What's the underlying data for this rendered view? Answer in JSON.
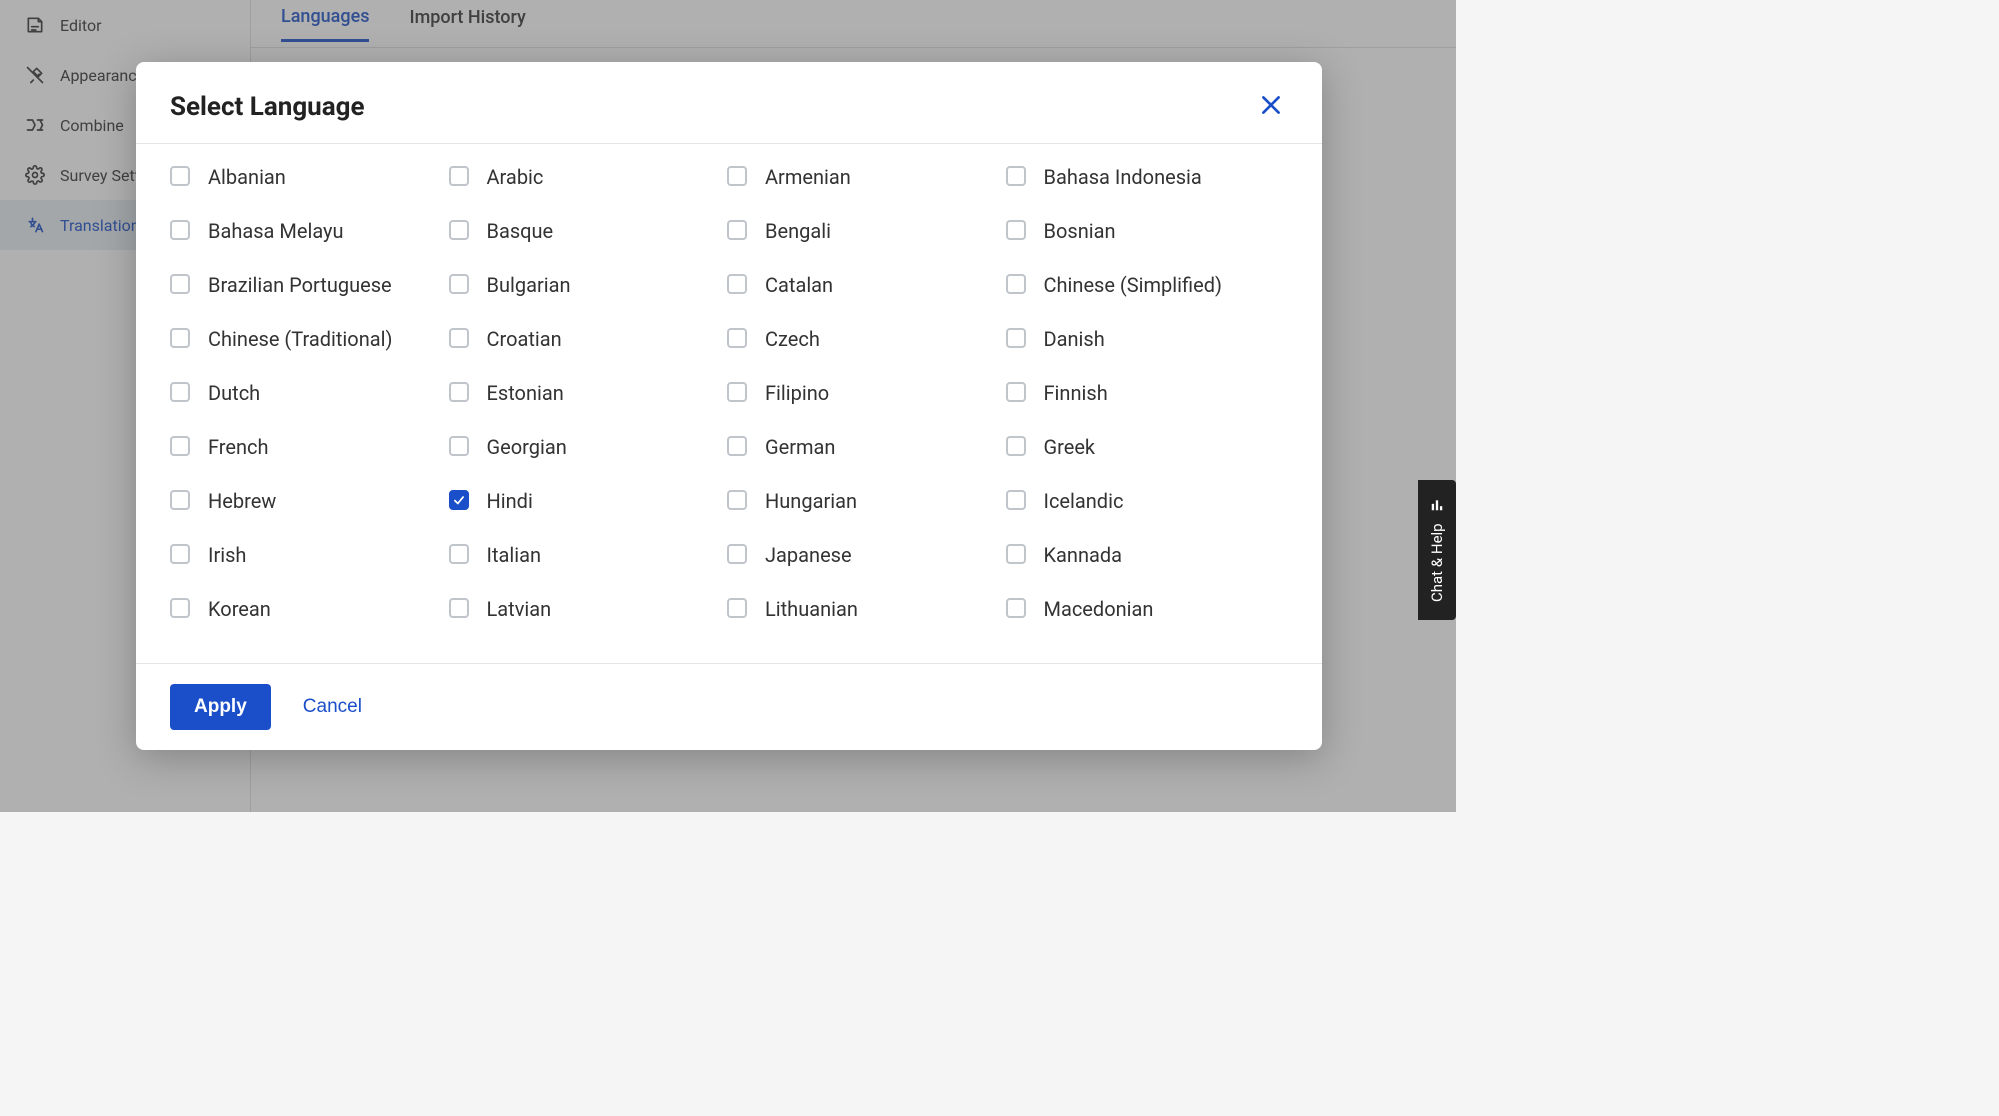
{
  "sidebar": {
    "items": [
      {
        "label": "Editor",
        "icon": "editor"
      },
      {
        "label": "Appearance",
        "icon": "appearance"
      },
      {
        "label": "Combine",
        "icon": "combine"
      },
      {
        "label": "Survey Settings",
        "icon": "settings"
      },
      {
        "label": "Translations",
        "icon": "translate",
        "active": true
      }
    ]
  },
  "tabs": {
    "items": [
      {
        "label": "Languages",
        "active": true
      },
      {
        "label": "Import History"
      }
    ]
  },
  "modal": {
    "title": "Select Language",
    "apply_label": "Apply",
    "cancel_label": "Cancel",
    "languages": [
      {
        "label": "Albanian",
        "checked": false
      },
      {
        "label": "Arabic",
        "checked": false
      },
      {
        "label": "Armenian",
        "checked": false
      },
      {
        "label": "Bahasa Indonesia",
        "checked": false
      },
      {
        "label": "Bahasa Melayu",
        "checked": false
      },
      {
        "label": "Basque",
        "checked": false
      },
      {
        "label": "Bengali",
        "checked": false
      },
      {
        "label": "Bosnian",
        "checked": false
      },
      {
        "label": "Brazilian Portuguese",
        "checked": false
      },
      {
        "label": "Bulgarian",
        "checked": false
      },
      {
        "label": "Catalan",
        "checked": false
      },
      {
        "label": "Chinese (Simplified)",
        "checked": false
      },
      {
        "label": "Chinese (Traditional)",
        "checked": false
      },
      {
        "label": "Croatian",
        "checked": false
      },
      {
        "label": "Czech",
        "checked": false
      },
      {
        "label": "Danish",
        "checked": false
      },
      {
        "label": "Dutch",
        "checked": false
      },
      {
        "label": "Estonian",
        "checked": false
      },
      {
        "label": "Filipino",
        "checked": false
      },
      {
        "label": "Finnish",
        "checked": false
      },
      {
        "label": "French",
        "checked": false
      },
      {
        "label": "Georgian",
        "checked": false
      },
      {
        "label": "German",
        "checked": false
      },
      {
        "label": "Greek",
        "checked": false
      },
      {
        "label": "Hebrew",
        "checked": false
      },
      {
        "label": "Hindi",
        "checked": true
      },
      {
        "label": "Hungarian",
        "checked": false
      },
      {
        "label": "Icelandic",
        "checked": false
      },
      {
        "label": "Irish",
        "checked": false
      },
      {
        "label": "Italian",
        "checked": false
      },
      {
        "label": "Japanese",
        "checked": false
      },
      {
        "label": "Kannada",
        "checked": false
      },
      {
        "label": "Korean",
        "checked": false
      },
      {
        "label": "Latvian",
        "checked": false
      },
      {
        "label": "Lithuanian",
        "checked": false
      },
      {
        "label": "Macedonian",
        "checked": false
      }
    ]
  },
  "chat_help": {
    "label": "Chat & Help"
  },
  "colors": {
    "primary": "#1a4fc9",
    "text": "#333",
    "border": "#e0e0e0"
  }
}
